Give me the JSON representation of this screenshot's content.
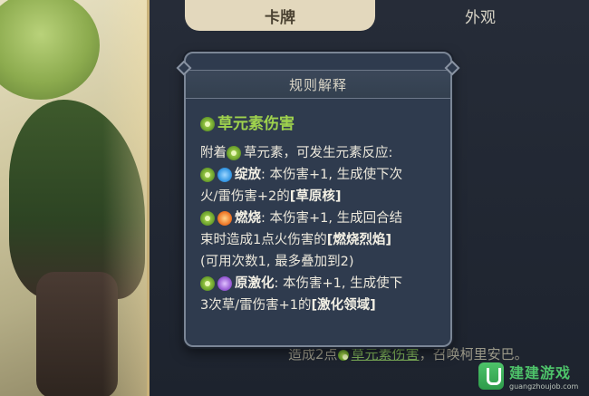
{
  "tabs": [
    {
      "label": "卡牌",
      "active": true
    },
    {
      "label": "外观",
      "active": false
    }
  ],
  "popup": {
    "title": "规则解释",
    "heading": "草元素伤害",
    "intro_prefix": "附着",
    "intro_suffix": "草元素，可发生元素反应:",
    "bloom": {
      "name": "绽放",
      "line1": ": 本伤害+1, 生成使下次",
      "line2": "火/雷伤害+2的",
      "status": "[草原核]"
    },
    "burning": {
      "name": "燃烧",
      "line1": ": 本伤害+1, 生成回合结",
      "line2": "束时造成1点火伤害的",
      "status": "[燃烧烈焰]",
      "line3": "(可用次数1, 最多叠加到2)"
    },
    "quicken": {
      "name": "原激化",
      "line1": ": 本伤害+1, 生成使下",
      "line2": "3次草/雷伤害+1的",
      "status": "[激化领域]"
    }
  },
  "summary": {
    "prefix": "造成2点",
    "highlight": "草元素伤害",
    "suffix": "，召唤柯里安巴。"
  },
  "watermark": {
    "name": "建建游戏",
    "url": "guangzhoujob.com"
  },
  "colors": {
    "dendro": "#9fd24d",
    "popup_bg": "#2f3b4e",
    "tab_active": "#e3d8bd"
  },
  "icons": [
    "dendro-icon",
    "hydro-icon",
    "pyro-icon",
    "electro-icon"
  ]
}
